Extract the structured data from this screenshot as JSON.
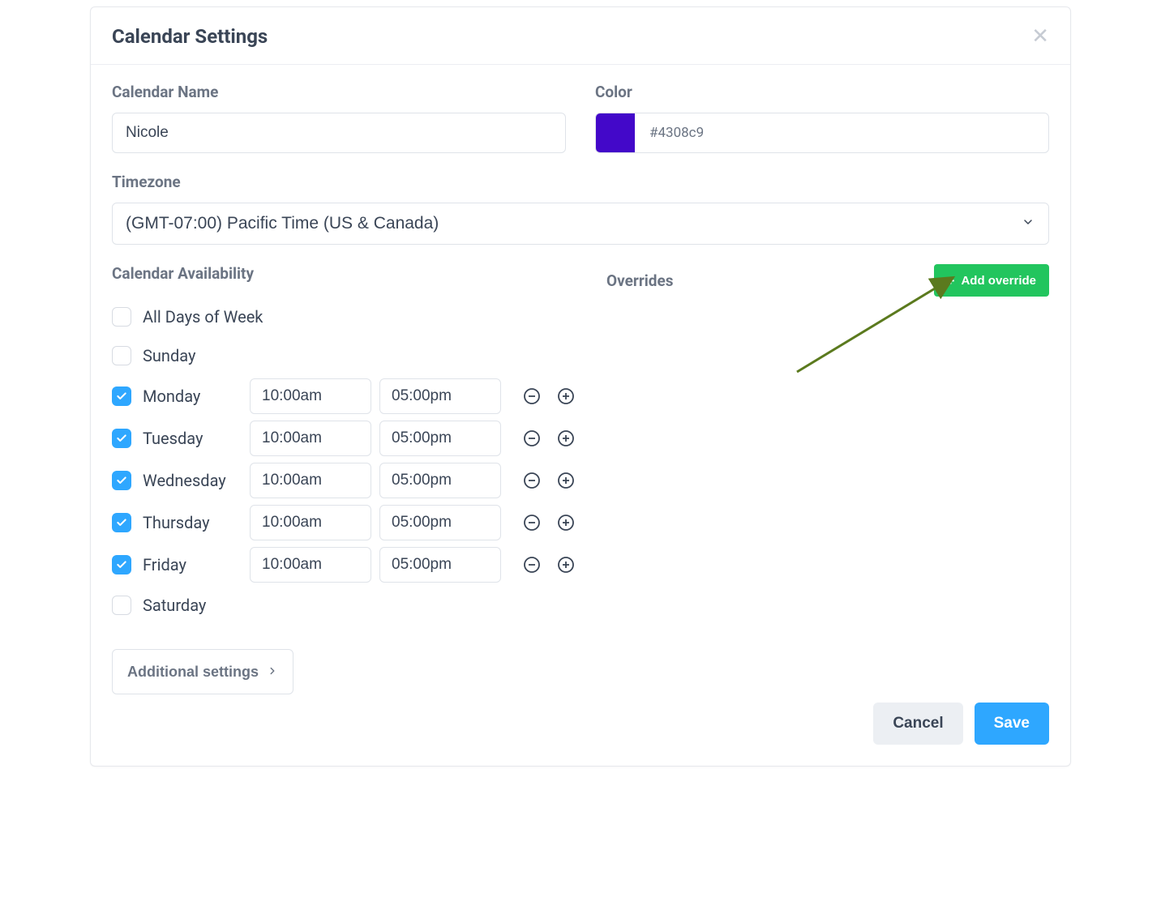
{
  "header": {
    "title": "Calendar Settings"
  },
  "fields": {
    "calendar_name_label": "Calendar Name",
    "calendar_name_value": "Nicole",
    "color_label": "Color",
    "color_hex": "#4308c9",
    "timezone_label": "Timezone",
    "timezone_value": "(GMT-07:00) Pacific Time (US & Canada)"
  },
  "availability": {
    "label": "Calendar Availability",
    "all_days_label": "All Days of Week",
    "days": [
      {
        "name": "Sunday",
        "checked": false,
        "start": "",
        "end": ""
      },
      {
        "name": "Monday",
        "checked": true,
        "start": "10:00am",
        "end": "05:00pm"
      },
      {
        "name": "Tuesday",
        "checked": true,
        "start": "10:00am",
        "end": "05:00pm"
      },
      {
        "name": "Wednesday",
        "checked": true,
        "start": "10:00am",
        "end": "05:00pm"
      },
      {
        "name": "Thursday",
        "checked": true,
        "start": "10:00am",
        "end": "05:00pm"
      },
      {
        "name": "Friday",
        "checked": true,
        "start": "10:00am",
        "end": "05:00pm"
      },
      {
        "name": "Saturday",
        "checked": false,
        "start": "",
        "end": ""
      }
    ],
    "additional_settings_label": "Additional settings"
  },
  "overrides": {
    "label": "Overrides",
    "add_label": "Add override"
  },
  "footer": {
    "cancel": "Cancel",
    "save": "Save"
  },
  "colors": {
    "accent_blue": "#2ea7ff",
    "accent_green": "#22c55e",
    "swatch": "#4308c9"
  }
}
